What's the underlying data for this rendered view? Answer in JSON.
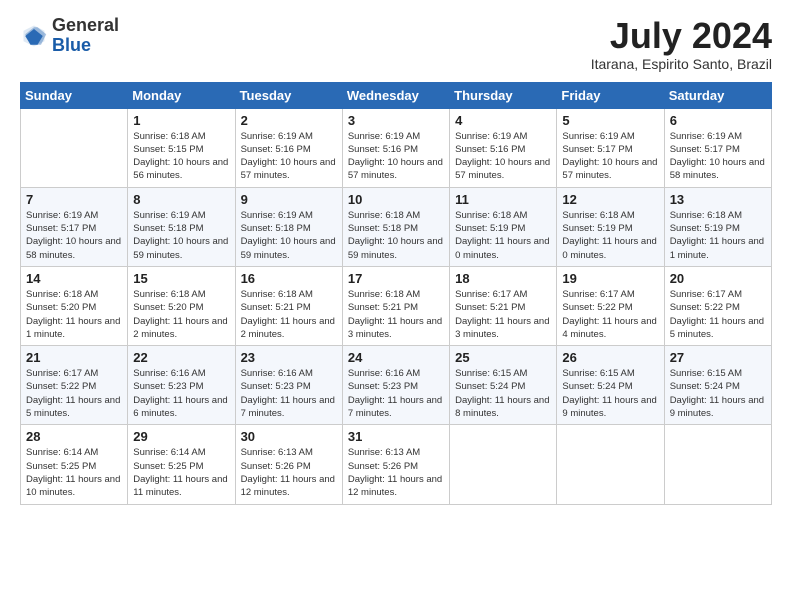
{
  "logo": {
    "general": "General",
    "blue": "Blue"
  },
  "title": "July 2024",
  "location": "Itarana, Espirito Santo, Brazil",
  "days_of_week": [
    "Sunday",
    "Monday",
    "Tuesday",
    "Wednesday",
    "Thursday",
    "Friday",
    "Saturday"
  ],
  "weeks": [
    [
      {
        "day": "",
        "info": ""
      },
      {
        "day": "1",
        "info": "Sunrise: 6:18 AM\nSunset: 5:15 PM\nDaylight: 10 hours and 56 minutes."
      },
      {
        "day": "2",
        "info": "Sunrise: 6:19 AM\nSunset: 5:16 PM\nDaylight: 10 hours and 57 minutes."
      },
      {
        "day": "3",
        "info": "Sunrise: 6:19 AM\nSunset: 5:16 PM\nDaylight: 10 hours and 57 minutes."
      },
      {
        "day": "4",
        "info": "Sunrise: 6:19 AM\nSunset: 5:16 PM\nDaylight: 10 hours and 57 minutes."
      },
      {
        "day": "5",
        "info": "Sunrise: 6:19 AM\nSunset: 5:17 PM\nDaylight: 10 hours and 57 minutes."
      },
      {
        "day": "6",
        "info": "Sunrise: 6:19 AM\nSunset: 5:17 PM\nDaylight: 10 hours and 58 minutes."
      }
    ],
    [
      {
        "day": "7",
        "info": "Sunrise: 6:19 AM\nSunset: 5:17 PM\nDaylight: 10 hours and 58 minutes."
      },
      {
        "day": "8",
        "info": "Sunrise: 6:19 AM\nSunset: 5:18 PM\nDaylight: 10 hours and 59 minutes."
      },
      {
        "day": "9",
        "info": "Sunrise: 6:19 AM\nSunset: 5:18 PM\nDaylight: 10 hours and 59 minutes."
      },
      {
        "day": "10",
        "info": "Sunrise: 6:18 AM\nSunset: 5:18 PM\nDaylight: 10 hours and 59 minutes."
      },
      {
        "day": "11",
        "info": "Sunrise: 6:18 AM\nSunset: 5:19 PM\nDaylight: 11 hours and 0 minutes."
      },
      {
        "day": "12",
        "info": "Sunrise: 6:18 AM\nSunset: 5:19 PM\nDaylight: 11 hours and 0 minutes."
      },
      {
        "day": "13",
        "info": "Sunrise: 6:18 AM\nSunset: 5:19 PM\nDaylight: 11 hours and 1 minute."
      }
    ],
    [
      {
        "day": "14",
        "info": "Sunrise: 6:18 AM\nSunset: 5:20 PM\nDaylight: 11 hours and 1 minute."
      },
      {
        "day": "15",
        "info": "Sunrise: 6:18 AM\nSunset: 5:20 PM\nDaylight: 11 hours and 2 minutes."
      },
      {
        "day": "16",
        "info": "Sunrise: 6:18 AM\nSunset: 5:21 PM\nDaylight: 11 hours and 2 minutes."
      },
      {
        "day": "17",
        "info": "Sunrise: 6:18 AM\nSunset: 5:21 PM\nDaylight: 11 hours and 3 minutes."
      },
      {
        "day": "18",
        "info": "Sunrise: 6:17 AM\nSunset: 5:21 PM\nDaylight: 11 hours and 3 minutes."
      },
      {
        "day": "19",
        "info": "Sunrise: 6:17 AM\nSunset: 5:22 PM\nDaylight: 11 hours and 4 minutes."
      },
      {
        "day": "20",
        "info": "Sunrise: 6:17 AM\nSunset: 5:22 PM\nDaylight: 11 hours and 5 minutes."
      }
    ],
    [
      {
        "day": "21",
        "info": "Sunrise: 6:17 AM\nSunset: 5:22 PM\nDaylight: 11 hours and 5 minutes."
      },
      {
        "day": "22",
        "info": "Sunrise: 6:16 AM\nSunset: 5:23 PM\nDaylight: 11 hours and 6 minutes."
      },
      {
        "day": "23",
        "info": "Sunrise: 6:16 AM\nSunset: 5:23 PM\nDaylight: 11 hours and 7 minutes."
      },
      {
        "day": "24",
        "info": "Sunrise: 6:16 AM\nSunset: 5:23 PM\nDaylight: 11 hours and 7 minutes."
      },
      {
        "day": "25",
        "info": "Sunrise: 6:15 AM\nSunset: 5:24 PM\nDaylight: 11 hours and 8 minutes."
      },
      {
        "day": "26",
        "info": "Sunrise: 6:15 AM\nSunset: 5:24 PM\nDaylight: 11 hours and 9 minutes."
      },
      {
        "day": "27",
        "info": "Sunrise: 6:15 AM\nSunset: 5:24 PM\nDaylight: 11 hours and 9 minutes."
      }
    ],
    [
      {
        "day": "28",
        "info": "Sunrise: 6:14 AM\nSunset: 5:25 PM\nDaylight: 11 hours and 10 minutes."
      },
      {
        "day": "29",
        "info": "Sunrise: 6:14 AM\nSunset: 5:25 PM\nDaylight: 11 hours and 11 minutes."
      },
      {
        "day": "30",
        "info": "Sunrise: 6:13 AM\nSunset: 5:26 PM\nDaylight: 11 hours and 12 minutes."
      },
      {
        "day": "31",
        "info": "Sunrise: 6:13 AM\nSunset: 5:26 PM\nDaylight: 11 hours and 12 minutes."
      },
      {
        "day": "",
        "info": ""
      },
      {
        "day": "",
        "info": ""
      },
      {
        "day": "",
        "info": ""
      }
    ]
  ]
}
